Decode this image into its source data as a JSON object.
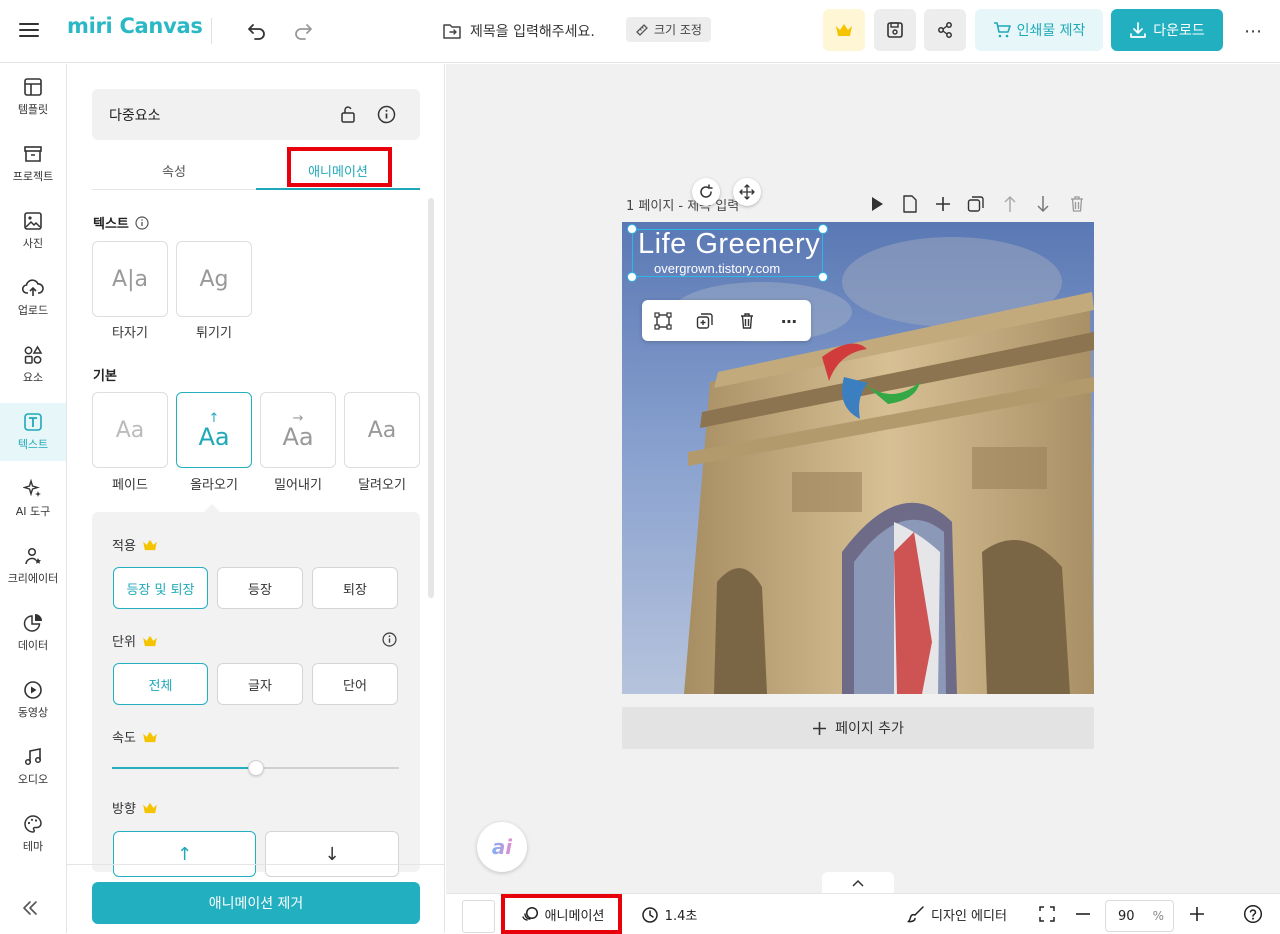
{
  "topbar": {
    "logo": "miri Canvas",
    "title_placeholder": "제목을 입력해주세요.",
    "resize_label": "크기 조정",
    "print_label": "인쇄물 제작",
    "download_label": "다운로드",
    "more": "⋯"
  },
  "sidebar": {
    "items": [
      {
        "label": "템플릿",
        "icon": "template-icon"
      },
      {
        "label": "프로젝트",
        "icon": "archive-icon"
      },
      {
        "label": "사진",
        "icon": "image-icon"
      },
      {
        "label": "업로드",
        "icon": "cloud-upload-icon"
      },
      {
        "label": "요소",
        "icon": "shapes-icon"
      },
      {
        "label": "텍스트",
        "icon": "text-icon",
        "active": true
      },
      {
        "label": "AI 도구",
        "icon": "sparkle-icon"
      },
      {
        "label": "크리에이터",
        "icon": "creator-icon"
      },
      {
        "label": "데이터",
        "icon": "chart-icon"
      },
      {
        "label": "동영상",
        "icon": "play-circle-icon"
      },
      {
        "label": "오디오",
        "icon": "music-icon"
      },
      {
        "label": "테마",
        "icon": "palette-icon"
      }
    ]
  },
  "panel": {
    "header": "다중요소",
    "tabs": [
      {
        "label": "속성",
        "active": false
      },
      {
        "label": "애니메이션",
        "active": true
      }
    ],
    "text_section": {
      "label": "텍스트",
      "items": [
        {
          "label": "타자기",
          "glyph": "A|a"
        },
        {
          "label": "튀기기",
          "glyph": "Ag"
        }
      ]
    },
    "basic_section": {
      "label": "기본",
      "items": [
        {
          "label": "페이드",
          "glyph": "Aa",
          "selected": false
        },
        {
          "label": "올라오기",
          "glyph": "Aa",
          "selected": true
        },
        {
          "label": "밀어내기",
          "glyph": "Aa",
          "selected": false
        },
        {
          "label": "달려오기",
          "glyph": "Aa",
          "selected": false
        }
      ]
    },
    "options": {
      "apply_label": "적용",
      "apply_options": [
        {
          "label": "등장 및 퇴장",
          "selected": true
        },
        {
          "label": "등장",
          "selected": false
        },
        {
          "label": "퇴장",
          "selected": false
        }
      ],
      "unit_label": "단위",
      "unit_options": [
        {
          "label": "전체",
          "selected": true
        },
        {
          "label": "글자",
          "selected": false
        },
        {
          "label": "단어",
          "selected": false
        }
      ],
      "speed_label": "속도",
      "speed_value": 0.5,
      "direction_label": "방향",
      "direction_options": [
        {
          "label": "↑",
          "selected": true
        },
        {
          "label": "↓",
          "selected": false
        }
      ]
    },
    "remove_button": "애니메이션 제거"
  },
  "canvas": {
    "page_label": "1 페이지 - 제목 입력",
    "title_text": "Life Greenery",
    "url_text": "overgrown.tistory.com",
    "add_page": "페이지 추가"
  },
  "bottombar": {
    "animation_label": "애니메이션",
    "duration": "1.4초",
    "design_editor": "디자인 에디터",
    "zoom": "90",
    "zoom_unit": "%"
  },
  "colors": {
    "accent": "#22b0c0",
    "highlight": "#e8000a"
  }
}
